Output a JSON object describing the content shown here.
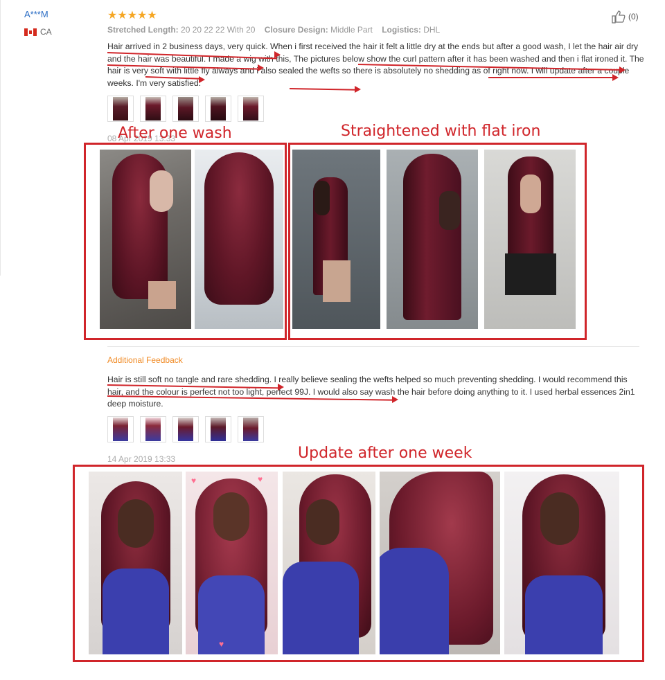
{
  "user": {
    "name": "A***M",
    "country": "CA"
  },
  "rating": {
    "stars": "★★★★★",
    "value": 5
  },
  "helpful": {
    "count": "(0)"
  },
  "attributes": [
    {
      "label": "Stretched Length:",
      "value": "20 20 22 22 With 20"
    },
    {
      "label": "Closure Design:",
      "value": "Middle Part"
    },
    {
      "label": "Logistics:",
      "value": "DHL"
    }
  ],
  "review": {
    "text": "Hair arrived in 2 business days, very quick. When i first received the hair it felt a little dry at the ends but after a good wash, I let the hair air dry and the hair was beautiful. I made a wig with this, The pictures below show the curl pattern after it has been washed and then i flat ironed it. The hair is very soft with little fly always and i also sealed the wefts so there is absolutely no shedding as of right now. I will update after a couple weeks. I'm very satisfied.",
    "date": "08 Apr 2019 13:33"
  },
  "annotations": {
    "after_wash": "After one wash",
    "straightened": "Straightened with flat iron",
    "update_week": "Update after one week"
  },
  "additional": {
    "heading": "Additional Feedback",
    "text": "Hair is still soft no tangle and rare shedding. I really believe sealing the wefts helped so much preventing shedding. I would recommend this hair, and the colour is perfect not too light, perfect 99J. I would also say wash the hair before doing anything to it. I used herbal essences 2in1 deep moisture.",
    "date": "14 Apr 2019 13:33"
  },
  "colors": {
    "accent_red": "#d0252a",
    "orange": "#f08a24",
    "star": "#f5a623",
    "link_blue": "#2a6cc4",
    "hair": "#6b1a2b"
  }
}
